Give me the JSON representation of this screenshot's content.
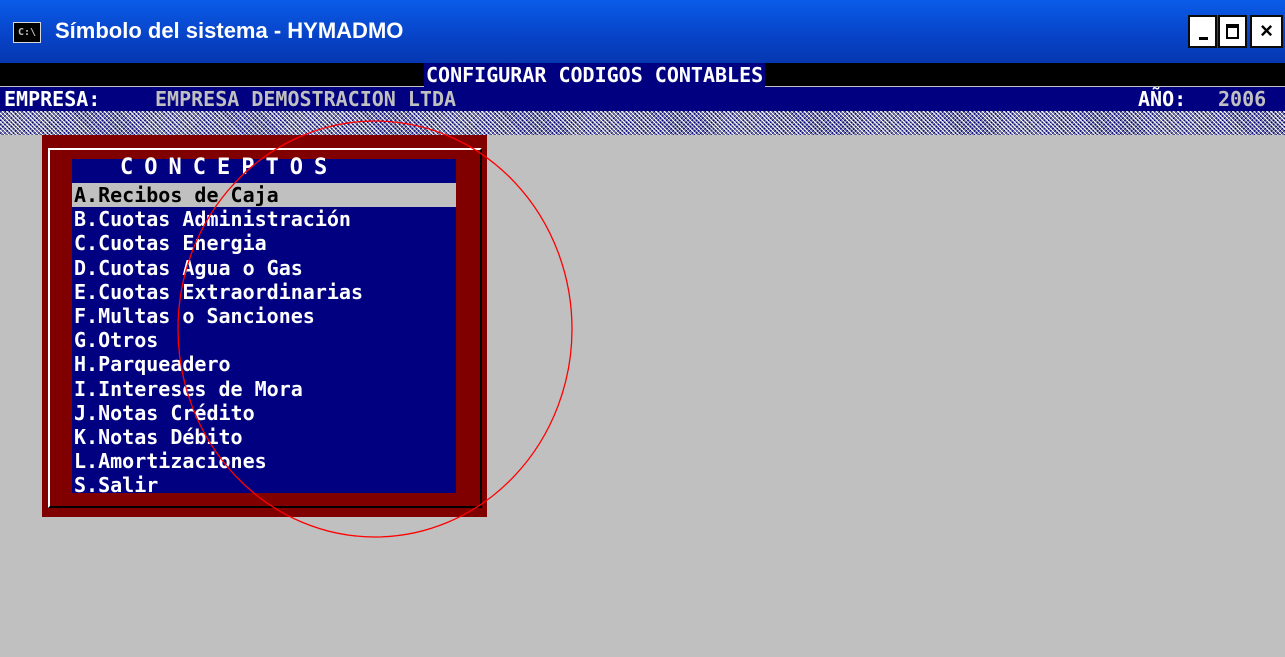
{
  "window": {
    "icon_text": "C:\\",
    "title": "Símbolo del sistema - HYMADMO",
    "controls": {
      "minimize": "minimize-icon",
      "maximize": "maximize-icon",
      "close": "close-icon",
      "close_glyph": "×"
    }
  },
  "header": {
    "title": "CONFIGURAR CODIGOS CONTABLES",
    "empresa_label": "EMPRESA:",
    "empresa_value": "EMPRESA DEMOSTRACION LTDA",
    "anio_label": "AÑO:",
    "anio_value": "2006"
  },
  "menu": {
    "heading": "CONCEPTOS",
    "selected_index": 0,
    "items": [
      {
        "label": "A.Recibos de Caja"
      },
      {
        "label": "B.Cuotas Administración"
      },
      {
        "label": "C.Cuotas Energia"
      },
      {
        "label": "D.Cuotas Agua o Gas"
      },
      {
        "label": "E.Cuotas Extraordinarias"
      },
      {
        "label": "F.Multas o Sanciones"
      },
      {
        "label": "G.Otros"
      },
      {
        "label": "H.Parqueadero"
      },
      {
        "label": "I.Intereses de Mora"
      },
      {
        "label": "J.Notas Crédito"
      },
      {
        "label": "K.Notas Débito"
      },
      {
        "label": "L.Amortizaciones"
      },
      {
        "label": "S.Salir"
      }
    ]
  },
  "colors": {
    "console_bg": "#c0c0c0",
    "navy": "#000080",
    "maroon": "#800000",
    "annotation": "#ff0000"
  }
}
